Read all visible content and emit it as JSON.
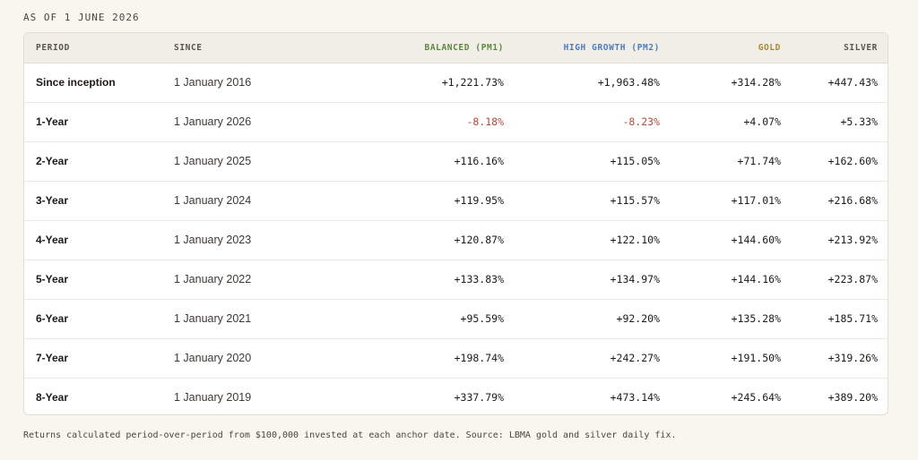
{
  "as_of": "AS OF 1 JUNE 2026",
  "table": {
    "headers": {
      "period": "PERIOD",
      "since": "SINCE",
      "balanced": "BALANCED (PM1)",
      "high_growth": "HIGH GROWTH (PM2)",
      "gold": "GOLD",
      "silver": "SILVER"
    },
    "header_colors": {
      "period": "#5b564e",
      "since": "#5b564e",
      "balanced": "#5a8a3c",
      "high_growth": "#4a7ec2",
      "gold": "#a88a2a",
      "silver": "#5b564e"
    },
    "negative_color": "#b44a3e",
    "rows": [
      {
        "period": "Since inception",
        "since": "1 January 2016",
        "balanced": "+1,221.73%",
        "high_growth": "+1,963.48%",
        "gold": "+314.28%",
        "silver": "+447.43%"
      },
      {
        "period": "1-Year",
        "since": "1 January 2026",
        "balanced": "-8.18%",
        "high_growth": "-8.23%",
        "gold": "+4.07%",
        "silver": "+5.33%"
      },
      {
        "period": "2-Year",
        "since": "1 January 2025",
        "balanced": "+116.16%",
        "high_growth": "+115.05%",
        "gold": "+71.74%",
        "silver": "+162.60%"
      },
      {
        "period": "3-Year",
        "since": "1 January 2024",
        "balanced": "+119.95%",
        "high_growth": "+115.57%",
        "gold": "+117.01%",
        "silver": "+216.68%"
      },
      {
        "period": "4-Year",
        "since": "1 January 2023",
        "balanced": "+120.87%",
        "high_growth": "+122.10%",
        "gold": "+144.60%",
        "silver": "+213.92%"
      },
      {
        "period": "5-Year",
        "since": "1 January 2022",
        "balanced": "+133.83%",
        "high_growth": "+134.97%",
        "gold": "+144.16%",
        "silver": "+223.87%"
      },
      {
        "period": "6-Year",
        "since": "1 January 2021",
        "balanced": "+95.59%",
        "high_growth": "+92.20%",
        "gold": "+135.28%",
        "silver": "+185.71%"
      },
      {
        "period": "7-Year",
        "since": "1 January 2020",
        "balanced": "+198.74%",
        "high_growth": "+242.27%",
        "gold": "+191.50%",
        "silver": "+319.26%"
      },
      {
        "period": "8-Year",
        "since": "1 January 2019",
        "balanced": "+337.79%",
        "high_growth": "+473.14%",
        "gold": "+245.64%",
        "silver": "+389.20%"
      }
    ]
  },
  "footnote": "Returns calculated period-over-period from $100,000 invested at each anchor date. Source: LBMA gold and silver daily fix."
}
